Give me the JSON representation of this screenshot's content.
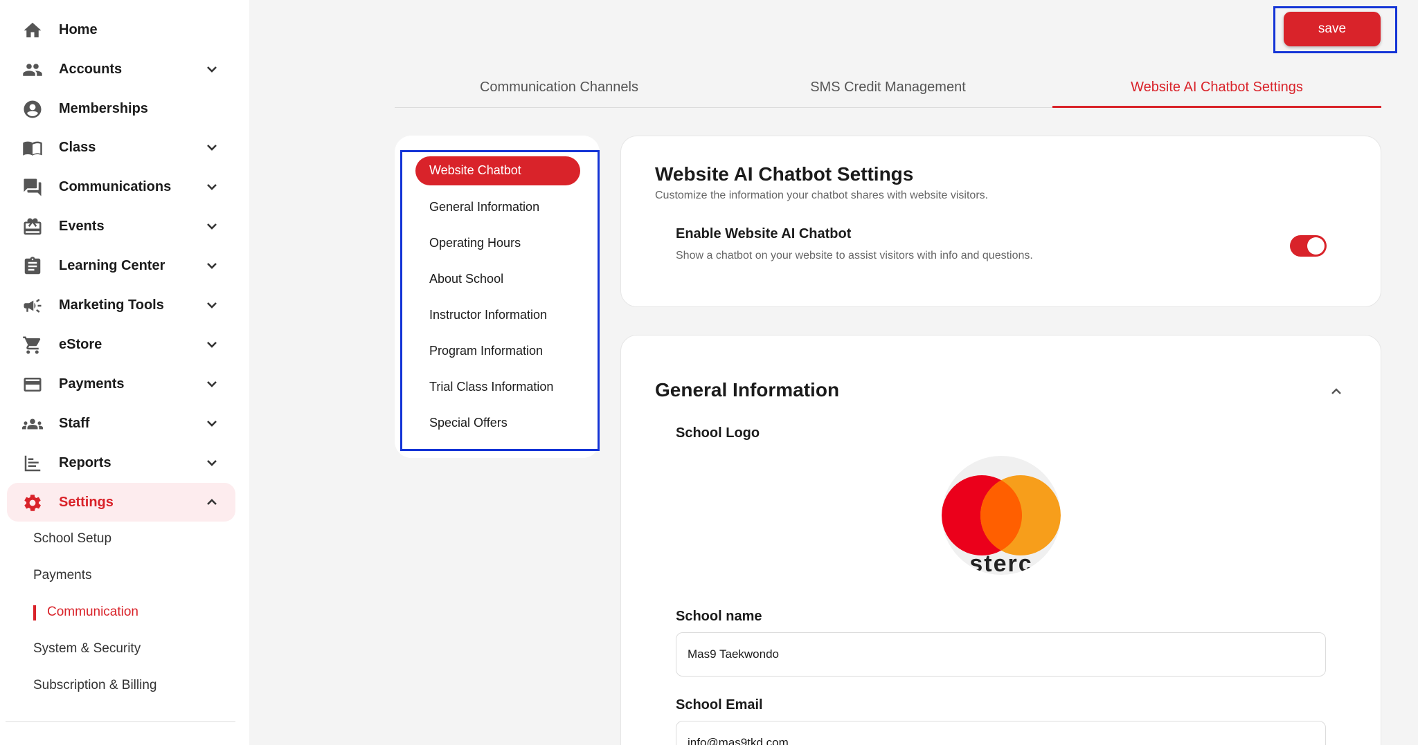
{
  "sidebar": {
    "items": [
      {
        "label": "Home",
        "icon": "home-icon"
      },
      {
        "label": "Accounts",
        "icon": "people-icon"
      },
      {
        "label": "Memberships",
        "icon": "account-circle-icon"
      },
      {
        "label": "Class",
        "icon": "book-icon"
      },
      {
        "label": "Communications",
        "icon": "chat-icon"
      },
      {
        "label": "Events",
        "icon": "gift-card-icon"
      },
      {
        "label": "Learning Center",
        "icon": "clipboard-icon"
      },
      {
        "label": "Marketing Tools",
        "icon": "megaphone-icon"
      },
      {
        "label": "eStore",
        "icon": "cart-icon"
      },
      {
        "label": "Payments",
        "icon": "credit-card-icon"
      },
      {
        "label": "Staff",
        "icon": "group-icon"
      },
      {
        "label": "Reports",
        "icon": "bar-chart-icon"
      },
      {
        "label": "Settings",
        "icon": "gear-icon"
      }
    ],
    "settings_sub": [
      "School Setup",
      "Payments",
      "Communication",
      "System & Security",
      "Subscription & Billing"
    ]
  },
  "toolbar": {
    "save_label": "save"
  },
  "tabs": [
    "Communication Channels",
    "SMS Credit Management",
    "Website AI Chatbot Settings"
  ],
  "subnav": [
    "Website Chatbot",
    "General Information",
    "Operating Hours",
    "About School",
    "Instructor Information",
    "Program Information",
    "Trial Class Information",
    "Special Offers"
  ],
  "chatbot_card": {
    "title": "Website AI Chatbot Settings",
    "subtitle": "Customize the information your chatbot shares with website visitors.",
    "enable_label": "Enable Website AI Chatbot",
    "enable_desc": "Show a chatbot on your website to assist visitors with info and questions.",
    "enabled": true
  },
  "general_card": {
    "title": "General Information",
    "logo_label": "School Logo",
    "logo_text": "sterc",
    "school_name_label": "School name",
    "school_name_value": "Mas9 Taekwondo",
    "school_email_label": "School Email",
    "school_email_value": "info@mas9tkd.com"
  },
  "colors": {
    "accent": "#d9232a",
    "highlight_box": "#1434d6",
    "logo_red": "#eb001b",
    "logo_orange": "#f79e1b",
    "logo_overlap": "#ff5f00"
  }
}
